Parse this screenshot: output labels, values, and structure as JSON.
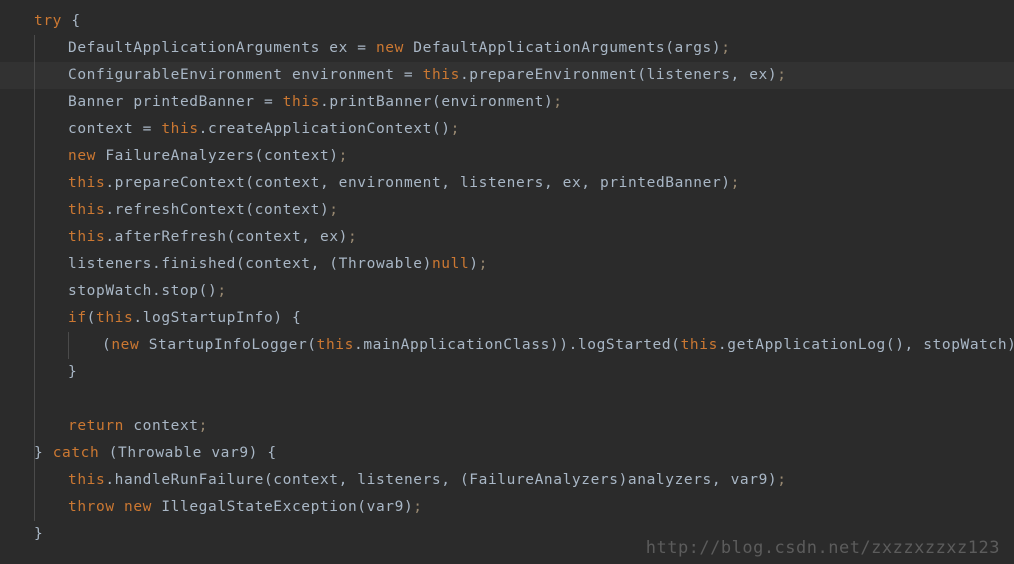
{
  "editor": {
    "background_color": "#2b2b2b",
    "highlight_color": "#323232",
    "keyword_color": "#cc7832",
    "identifier_color": "#a9b7c6",
    "punctuation_color": "#9a8a72",
    "indent_guide_color": "#4b4b4b",
    "language": "java",
    "current_line_index": 2,
    "lines": [
      {
        "indent": 1,
        "text": "try {"
      },
      {
        "indent": 2,
        "text": "DefaultApplicationArguments ex = new DefaultApplicationArguments(args);"
      },
      {
        "indent": 2,
        "text": "ConfigurableEnvironment environment = this.prepareEnvironment(listeners, ex);"
      },
      {
        "indent": 2,
        "text": "Banner printedBanner = this.printBanner(environment);"
      },
      {
        "indent": 2,
        "text": "context = this.createApplicationContext();"
      },
      {
        "indent": 2,
        "text": "new FailureAnalyzers(context);"
      },
      {
        "indent": 2,
        "text": "this.prepareContext(context, environment, listeners, ex, printedBanner);"
      },
      {
        "indent": 2,
        "text": "this.refreshContext(context);"
      },
      {
        "indent": 2,
        "text": "this.afterRefresh(context, ex);"
      },
      {
        "indent": 2,
        "text": "listeners.finished(context, (Throwable)null);"
      },
      {
        "indent": 2,
        "text": "stopWatch.stop();"
      },
      {
        "indent": 2,
        "text": "if(this.logStartupInfo) {"
      },
      {
        "indent": 3,
        "text": "(new StartupInfoLogger(this.mainApplicationClass)).logStarted(this.getApplicationLog(), stopWatch);"
      },
      {
        "indent": 2,
        "text": "}"
      },
      {
        "indent": 0,
        "text": ""
      },
      {
        "indent": 2,
        "text": "return context;"
      },
      {
        "indent": 1,
        "text": "} catch (Throwable var9) {"
      },
      {
        "indent": 2,
        "text": "this.handleRunFailure(context, listeners, (FailureAnalyzers)analyzers, var9);"
      },
      {
        "indent": 2,
        "text": "throw new IllegalStateException(var9);"
      },
      {
        "indent": 1,
        "text": "}"
      }
    ],
    "keywords": [
      "try",
      "new",
      "this",
      "if",
      "catch",
      "throw",
      "return",
      "null"
    ]
  },
  "watermark": {
    "text": "http://blog.csdn.net/zxzzxzzxz123",
    "color": "#5c5c5c"
  }
}
